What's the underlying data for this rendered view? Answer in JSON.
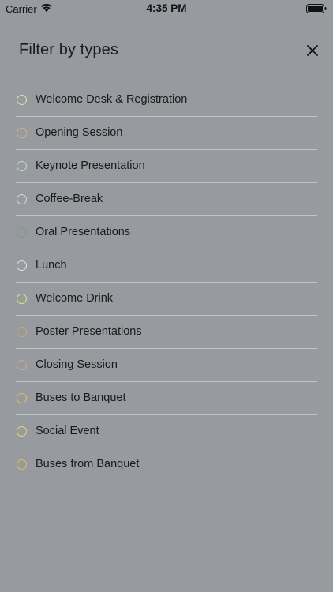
{
  "status_bar": {
    "carrier": "Carrier",
    "time": "4:35 PM"
  },
  "header": {
    "title": "Filter by types",
    "close_icon": "close-icon"
  },
  "types": [
    {
      "label": "Welcome Desk & Registration",
      "color": "#E4E3A2"
    },
    {
      "label": "Opening Session",
      "color": "#D6AE8F"
    },
    {
      "label": "Keynote Presentation",
      "color": "#C6DDC6"
    },
    {
      "label": "Coffee-Break",
      "color": "#D7D7D7"
    },
    {
      "label": "Oral Presentations",
      "color": "#6FA56F"
    },
    {
      "label": "Lunch",
      "color": "#E2E2E2"
    },
    {
      "label": "Welcome Drink",
      "color": "#E8E07A"
    },
    {
      "label": "Poster Presentations",
      "color": "#D9A45C"
    },
    {
      "label": "Closing Session",
      "color": "#D2A694"
    },
    {
      "label": "Buses to Banquet",
      "color": "#E3C25A"
    },
    {
      "label": "Social Event",
      "color": "#E7D870"
    },
    {
      "label": "Buses from Banquet",
      "color": "#E0BE4E"
    }
  ]
}
